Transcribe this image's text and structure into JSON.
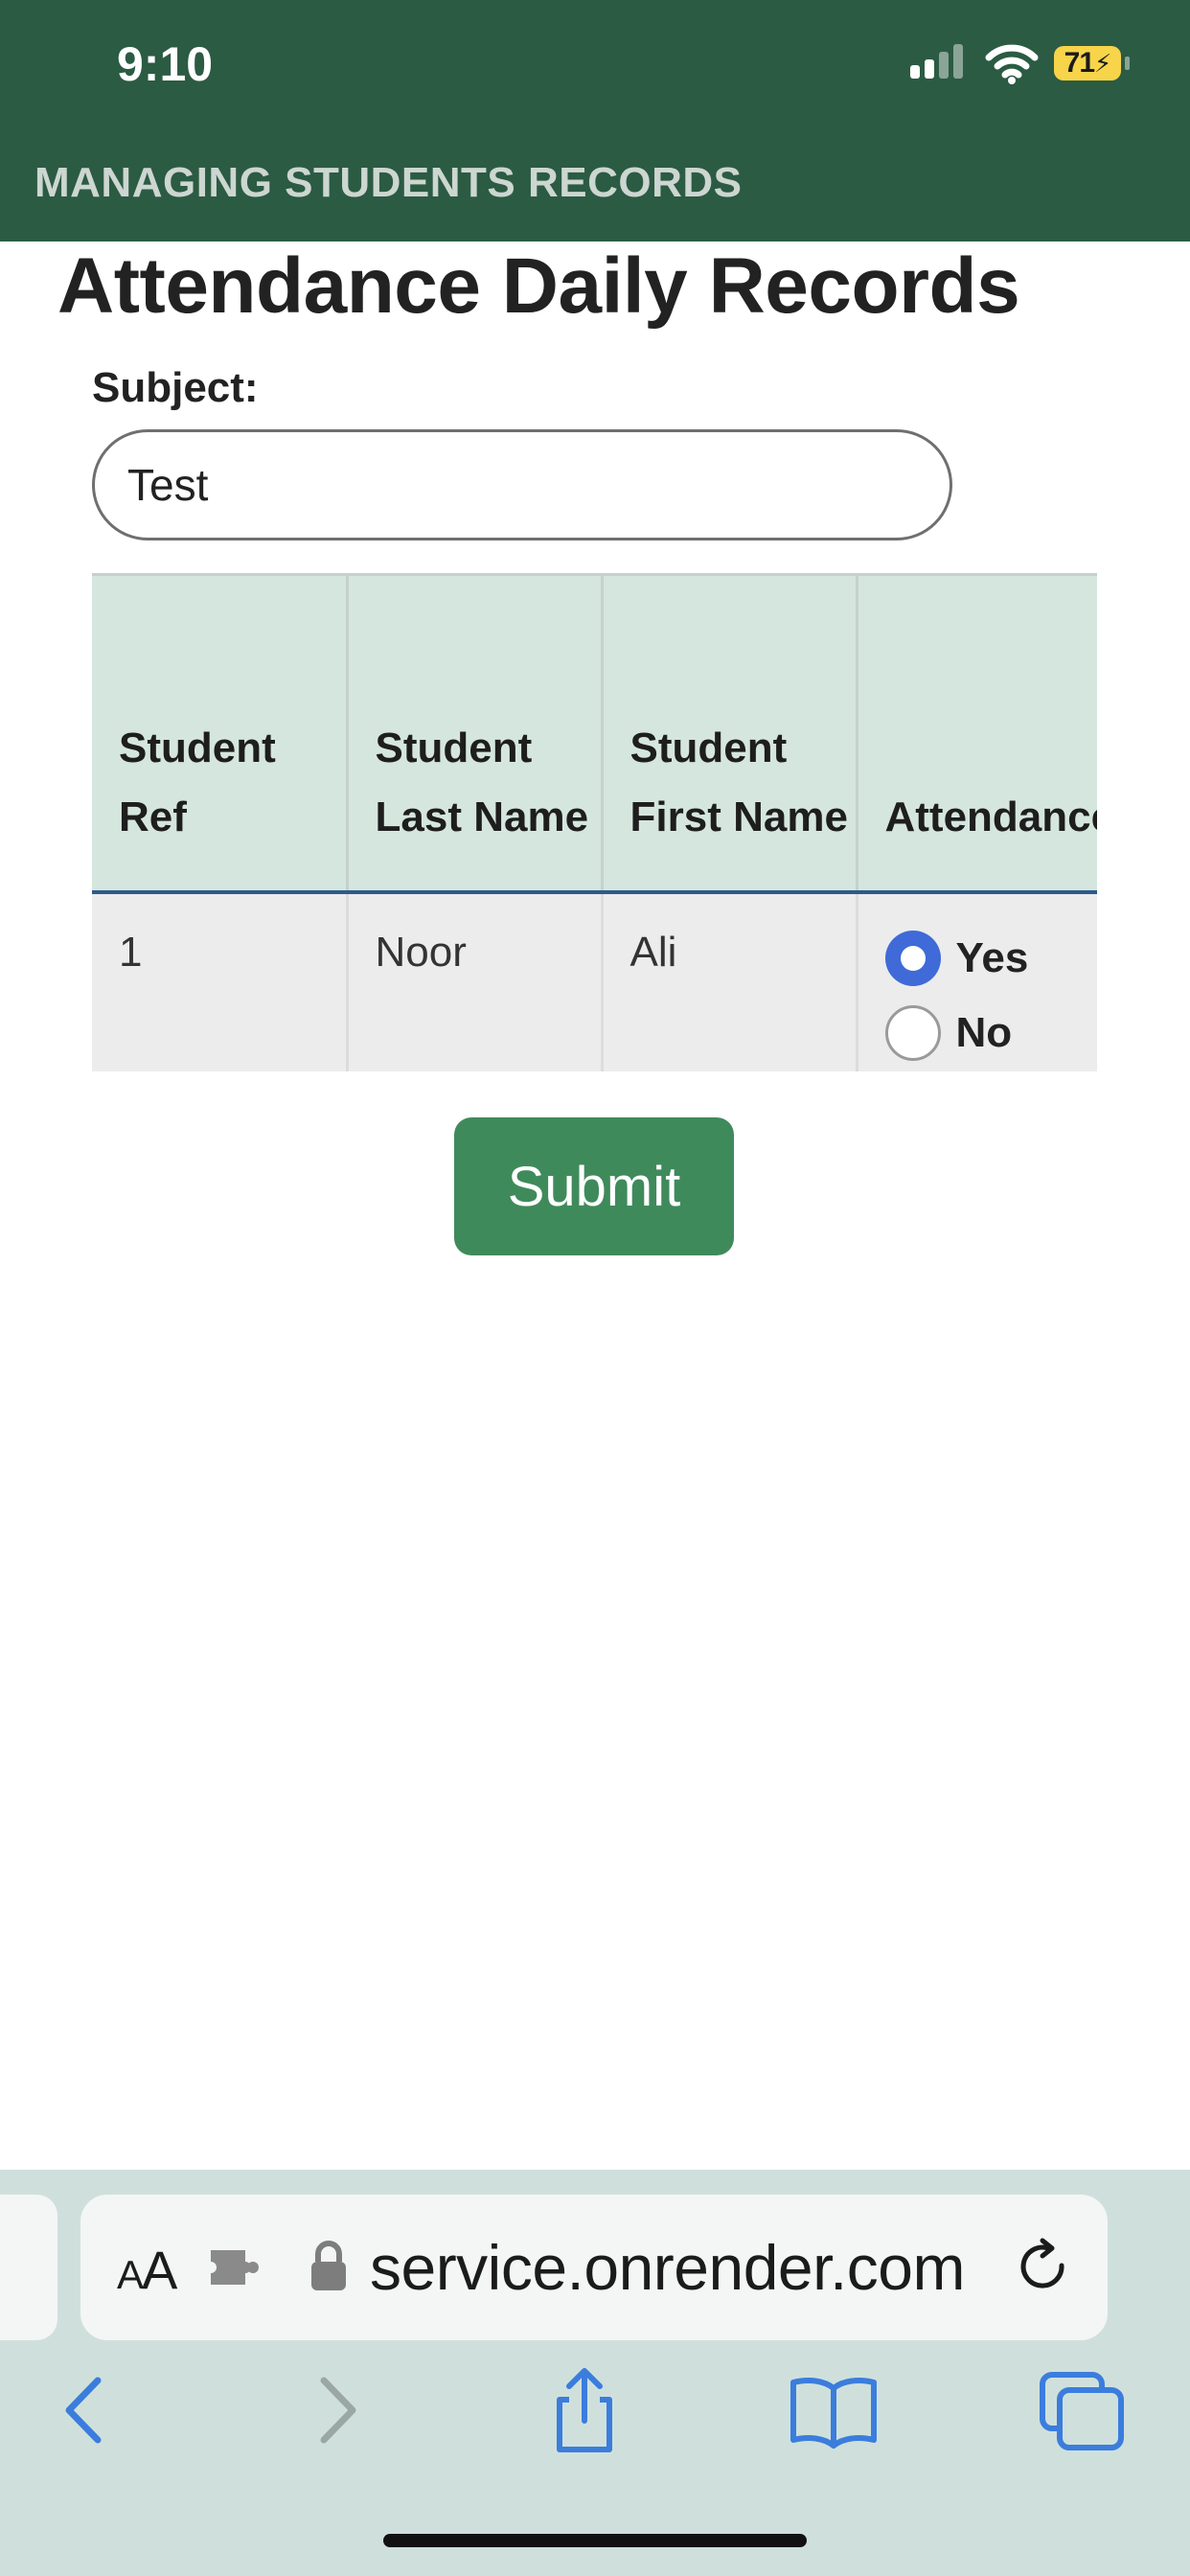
{
  "status_bar": {
    "time": "9:10",
    "battery_level": "71",
    "signal_icon": "cellular-signal-icon",
    "wifi_icon": "wifi-icon"
  },
  "header": {
    "title": "MANAGING STUDENTS RECORDS",
    "background_color": "#2b5b43"
  },
  "page": {
    "title": "Attendance Daily Records"
  },
  "subject": {
    "label": "Subject:",
    "value": "Test"
  },
  "table": {
    "columns": [
      "Student Ref",
      "Student Last Name",
      "Student First Name",
      "Attendance"
    ],
    "rows": [
      {
        "ref": "1",
        "last_name": "Noor",
        "first_name": "Ali",
        "attendance": "Yes"
      }
    ],
    "attendance_options": [
      "Yes",
      "No"
    ]
  },
  "submit": {
    "label": "Submit",
    "color": "#3f8a5b"
  },
  "browser": {
    "text_size_small": "A",
    "text_size_large": "A",
    "url": "service.onrender.com",
    "accent_color": "#3b7ddd"
  }
}
